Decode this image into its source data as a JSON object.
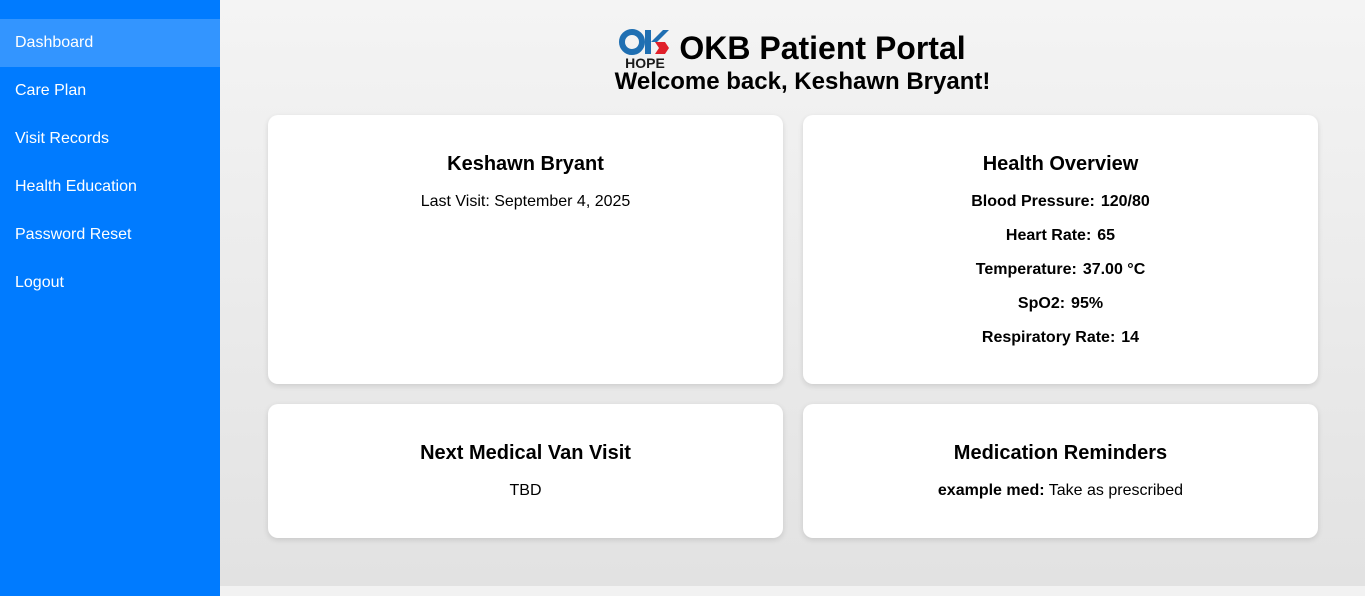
{
  "sidebar": {
    "items": [
      {
        "label": "Dashboard",
        "active": true
      },
      {
        "label": "Care Plan"
      },
      {
        "label": "Visit Records"
      },
      {
        "label": "Health Education"
      },
      {
        "label": "Password Reset"
      },
      {
        "label": "Logout"
      }
    ]
  },
  "header": {
    "logo_text": "HOPE",
    "title": "OKB Patient Portal",
    "welcome": "Welcome back, Keshawn Bryant!"
  },
  "patient_card": {
    "name": "Keshawn Bryant",
    "last_visit": "Last Visit: September 4, 2025"
  },
  "health_overview": {
    "title": "Health Overview",
    "vitals": [
      {
        "label": "Blood Pressure:",
        "value": "120/80"
      },
      {
        "label": "Heart Rate:",
        "value": "65"
      },
      {
        "label": "Temperature:",
        "value": "37.00 °C"
      },
      {
        "label": "SpO2:",
        "value": "95%"
      },
      {
        "label": "Respiratory Rate:",
        "value": "14"
      }
    ]
  },
  "next_visit": {
    "title": "Next Medical Van Visit",
    "value": "TBD"
  },
  "medications": {
    "title": "Medication Reminders",
    "items": [
      {
        "name": "example med:",
        "instruction": "Take as prescribed"
      }
    ]
  },
  "colors": {
    "sidebar": "#007bff",
    "sidebar_active": "#3395ff",
    "logo_blue": "#1f6fb2",
    "logo_red": "#e0202a"
  }
}
